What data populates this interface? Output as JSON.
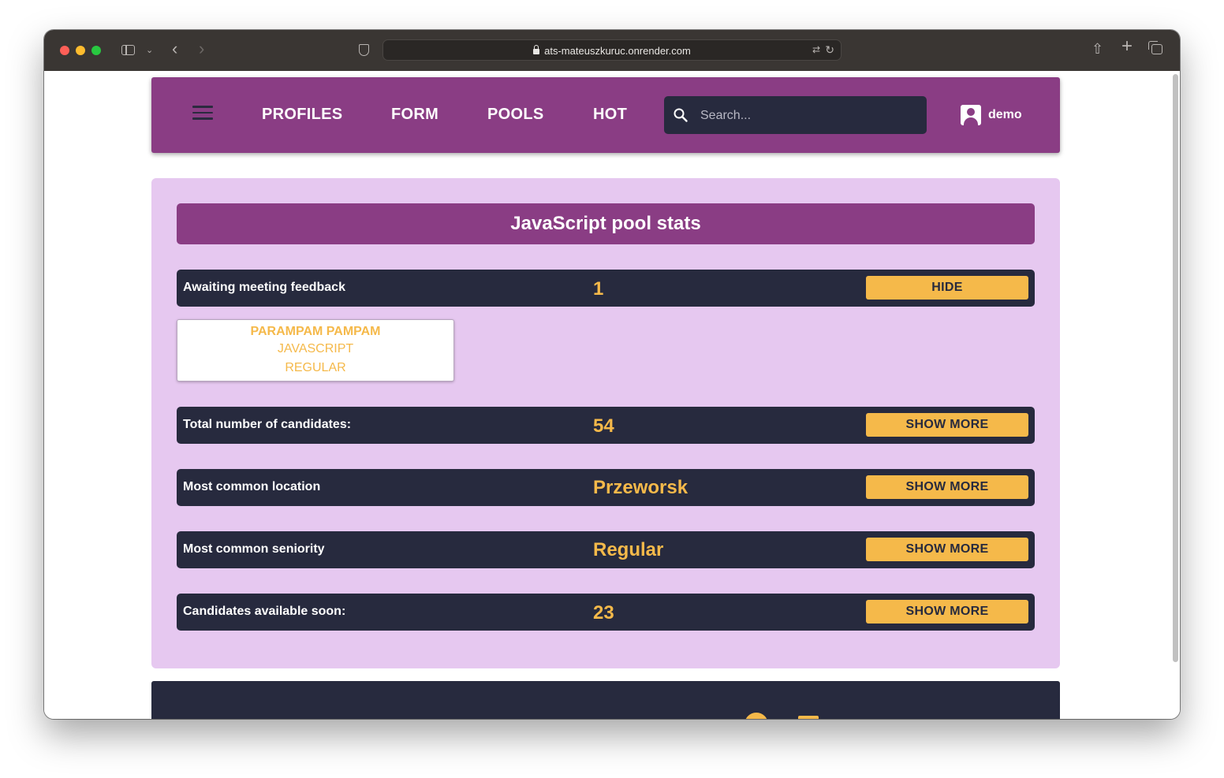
{
  "browser": {
    "url": "ats-mateuszkuruc.onrender.com"
  },
  "nav": {
    "links": [
      "PROFILES",
      "FORM",
      "POOLS",
      "HOT"
    ],
    "search_placeholder": "Search...",
    "user": "demo"
  },
  "panel": {
    "title": "JavaScript pool stats",
    "rows": [
      {
        "label": "Awaiting meeting feedback",
        "value": "1",
        "button": "HIDE"
      },
      {
        "label": "Total number of candidates:",
        "value": "54",
        "button": "SHOW MORE"
      },
      {
        "label": "Most common location",
        "value": "Przeworsk",
        "button": "SHOW MORE"
      },
      {
        "label": "Most common seniority",
        "value": "Regular",
        "button": "SHOW MORE"
      },
      {
        "label": "Candidates available soon:",
        "value": "23",
        "button": "SHOW MORE"
      }
    ],
    "candidate": {
      "name": "PARAMPAM PAMPAM",
      "technology": "JAVASCRIPT",
      "level": "REGULAR"
    }
  },
  "colors": {
    "accent_purple": "#8a3d84",
    "panel_bg": "#e6c8f0",
    "dark": "#272a3e",
    "gold": "#f5b94a"
  }
}
